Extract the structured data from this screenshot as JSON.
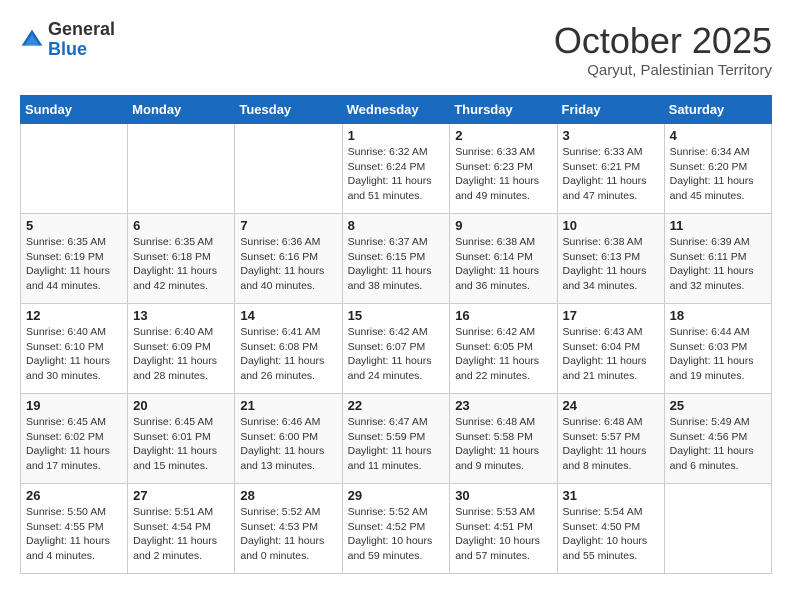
{
  "header": {
    "logo_general": "General",
    "logo_blue": "Blue",
    "month_title": "October 2025",
    "location": "Qaryut, Palestinian Territory"
  },
  "weekdays": [
    "Sunday",
    "Monday",
    "Tuesday",
    "Wednesday",
    "Thursday",
    "Friday",
    "Saturday"
  ],
  "weeks": [
    [
      {
        "day": "",
        "info": ""
      },
      {
        "day": "",
        "info": ""
      },
      {
        "day": "",
        "info": ""
      },
      {
        "day": "1",
        "info": "Sunrise: 6:32 AM\nSunset: 6:24 PM\nDaylight: 11 hours\nand 51 minutes."
      },
      {
        "day": "2",
        "info": "Sunrise: 6:33 AM\nSunset: 6:23 PM\nDaylight: 11 hours\nand 49 minutes."
      },
      {
        "day": "3",
        "info": "Sunrise: 6:33 AM\nSunset: 6:21 PM\nDaylight: 11 hours\nand 47 minutes."
      },
      {
        "day": "4",
        "info": "Sunrise: 6:34 AM\nSunset: 6:20 PM\nDaylight: 11 hours\nand 45 minutes."
      }
    ],
    [
      {
        "day": "5",
        "info": "Sunrise: 6:35 AM\nSunset: 6:19 PM\nDaylight: 11 hours\nand 44 minutes."
      },
      {
        "day": "6",
        "info": "Sunrise: 6:35 AM\nSunset: 6:18 PM\nDaylight: 11 hours\nand 42 minutes."
      },
      {
        "day": "7",
        "info": "Sunrise: 6:36 AM\nSunset: 6:16 PM\nDaylight: 11 hours\nand 40 minutes."
      },
      {
        "day": "8",
        "info": "Sunrise: 6:37 AM\nSunset: 6:15 PM\nDaylight: 11 hours\nand 38 minutes."
      },
      {
        "day": "9",
        "info": "Sunrise: 6:38 AM\nSunset: 6:14 PM\nDaylight: 11 hours\nand 36 minutes."
      },
      {
        "day": "10",
        "info": "Sunrise: 6:38 AM\nSunset: 6:13 PM\nDaylight: 11 hours\nand 34 minutes."
      },
      {
        "day": "11",
        "info": "Sunrise: 6:39 AM\nSunset: 6:11 PM\nDaylight: 11 hours\nand 32 minutes."
      }
    ],
    [
      {
        "day": "12",
        "info": "Sunrise: 6:40 AM\nSunset: 6:10 PM\nDaylight: 11 hours\nand 30 minutes."
      },
      {
        "day": "13",
        "info": "Sunrise: 6:40 AM\nSunset: 6:09 PM\nDaylight: 11 hours\nand 28 minutes."
      },
      {
        "day": "14",
        "info": "Sunrise: 6:41 AM\nSunset: 6:08 PM\nDaylight: 11 hours\nand 26 minutes."
      },
      {
        "day": "15",
        "info": "Sunrise: 6:42 AM\nSunset: 6:07 PM\nDaylight: 11 hours\nand 24 minutes."
      },
      {
        "day": "16",
        "info": "Sunrise: 6:42 AM\nSunset: 6:05 PM\nDaylight: 11 hours\nand 22 minutes."
      },
      {
        "day": "17",
        "info": "Sunrise: 6:43 AM\nSunset: 6:04 PM\nDaylight: 11 hours\nand 21 minutes."
      },
      {
        "day": "18",
        "info": "Sunrise: 6:44 AM\nSunset: 6:03 PM\nDaylight: 11 hours\nand 19 minutes."
      }
    ],
    [
      {
        "day": "19",
        "info": "Sunrise: 6:45 AM\nSunset: 6:02 PM\nDaylight: 11 hours\nand 17 minutes."
      },
      {
        "day": "20",
        "info": "Sunrise: 6:45 AM\nSunset: 6:01 PM\nDaylight: 11 hours\nand 15 minutes."
      },
      {
        "day": "21",
        "info": "Sunrise: 6:46 AM\nSunset: 6:00 PM\nDaylight: 11 hours\nand 13 minutes."
      },
      {
        "day": "22",
        "info": "Sunrise: 6:47 AM\nSunset: 5:59 PM\nDaylight: 11 hours\nand 11 minutes."
      },
      {
        "day": "23",
        "info": "Sunrise: 6:48 AM\nSunset: 5:58 PM\nDaylight: 11 hours\nand 9 minutes."
      },
      {
        "day": "24",
        "info": "Sunrise: 6:48 AM\nSunset: 5:57 PM\nDaylight: 11 hours\nand 8 minutes."
      },
      {
        "day": "25",
        "info": "Sunrise: 5:49 AM\nSunset: 4:56 PM\nDaylight: 11 hours\nand 6 minutes."
      }
    ],
    [
      {
        "day": "26",
        "info": "Sunrise: 5:50 AM\nSunset: 4:55 PM\nDaylight: 11 hours\nand 4 minutes."
      },
      {
        "day": "27",
        "info": "Sunrise: 5:51 AM\nSunset: 4:54 PM\nDaylight: 11 hours\nand 2 minutes."
      },
      {
        "day": "28",
        "info": "Sunrise: 5:52 AM\nSunset: 4:53 PM\nDaylight: 11 hours\nand 0 minutes."
      },
      {
        "day": "29",
        "info": "Sunrise: 5:52 AM\nSunset: 4:52 PM\nDaylight: 10 hours\nand 59 minutes."
      },
      {
        "day": "30",
        "info": "Sunrise: 5:53 AM\nSunset: 4:51 PM\nDaylight: 10 hours\nand 57 minutes."
      },
      {
        "day": "31",
        "info": "Sunrise: 5:54 AM\nSunset: 4:50 PM\nDaylight: 10 hours\nand 55 minutes."
      },
      {
        "day": "",
        "info": ""
      }
    ]
  ]
}
